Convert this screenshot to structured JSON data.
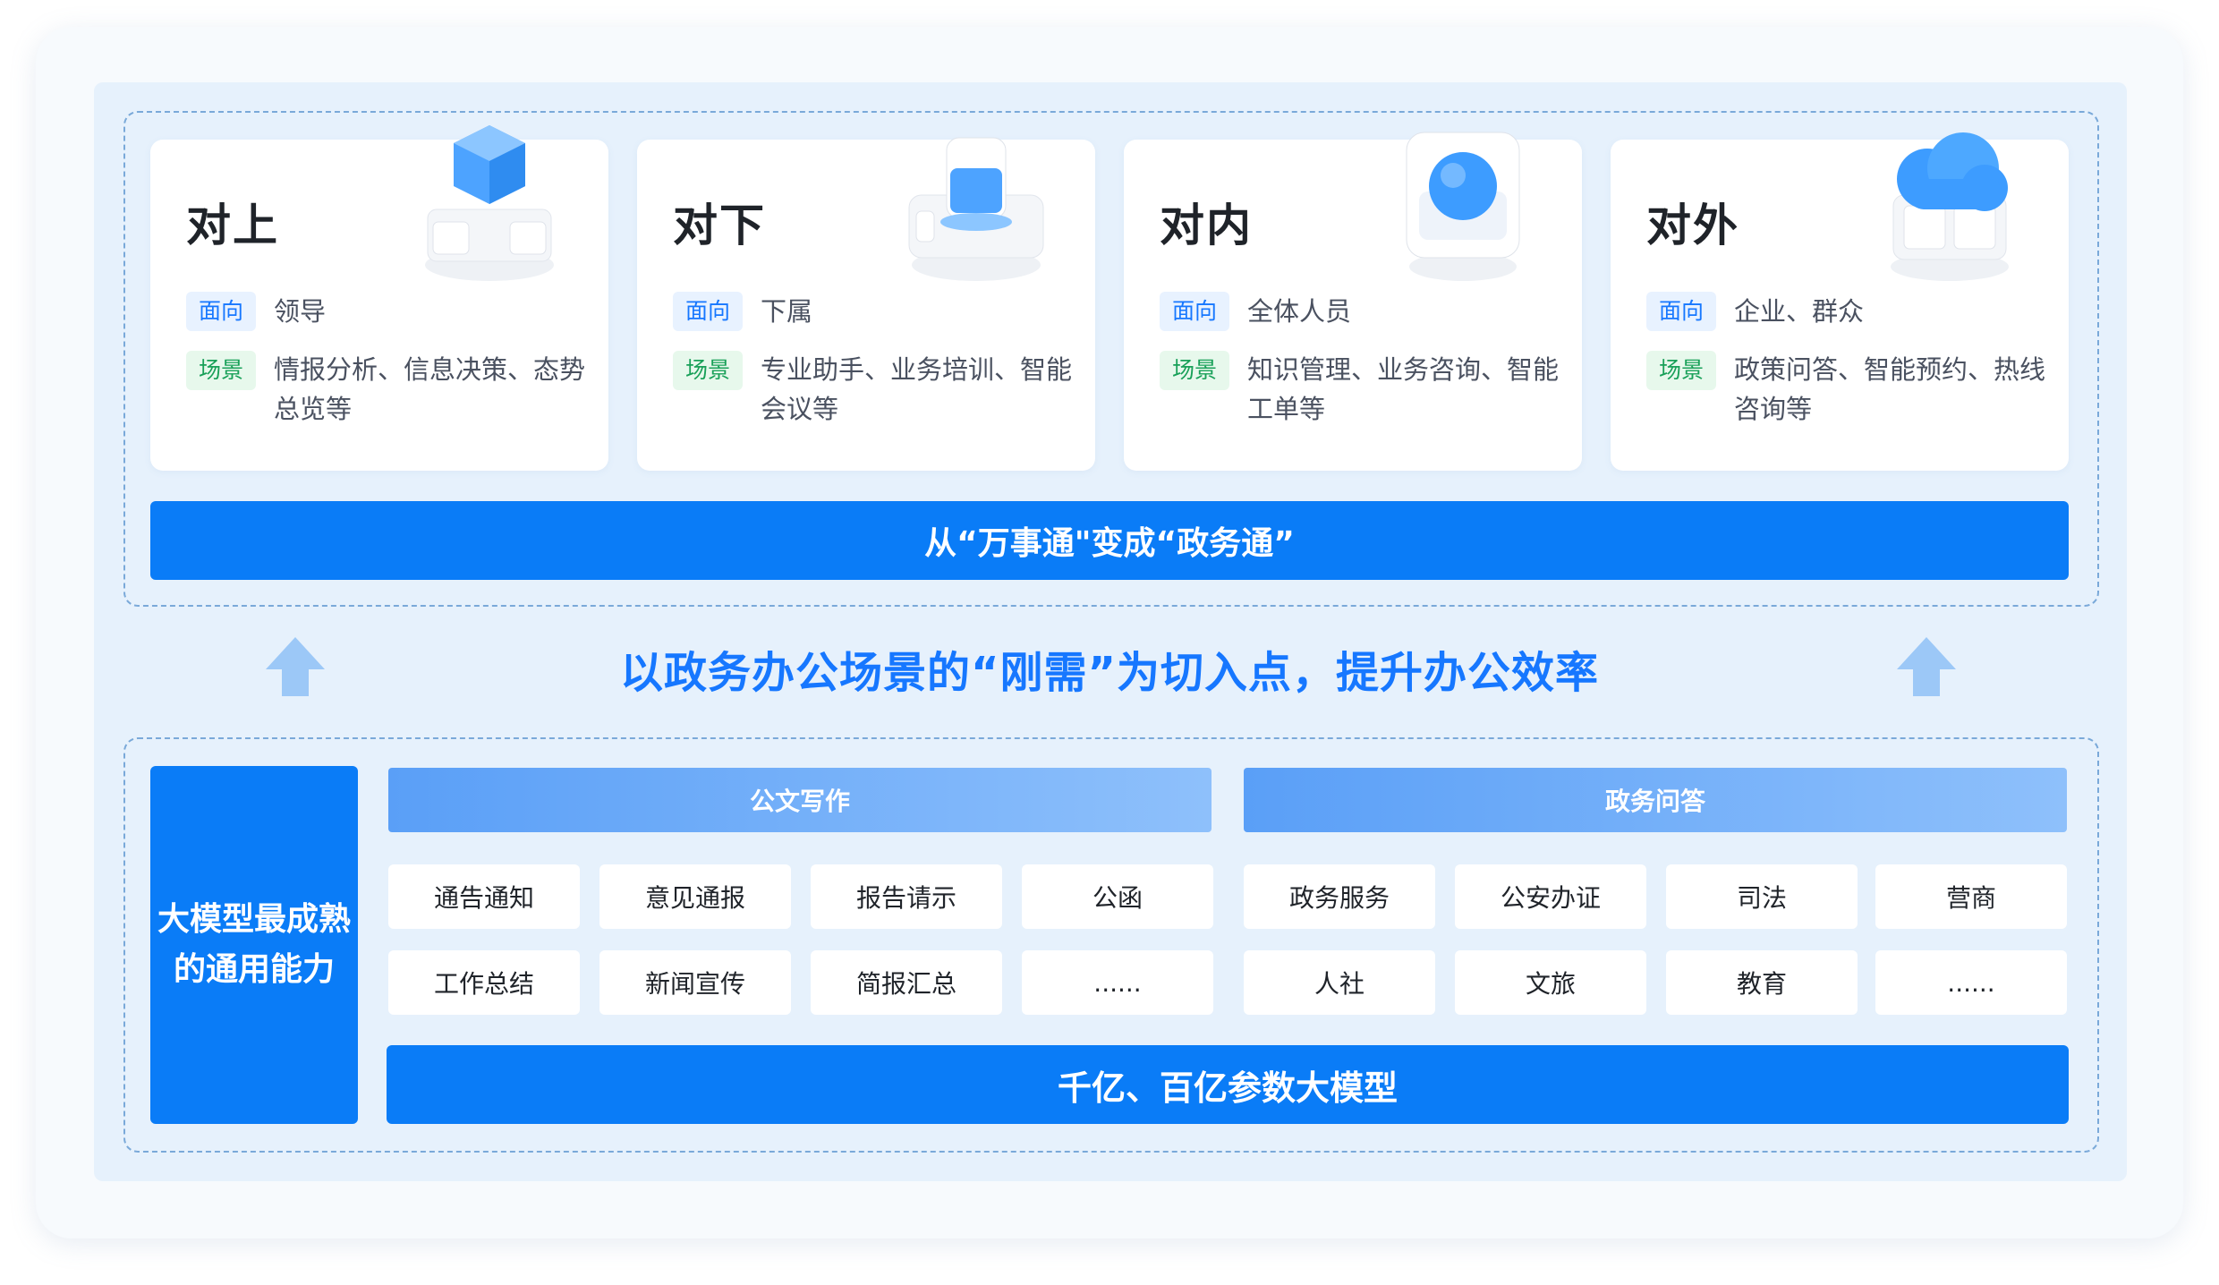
{
  "features": [
    {
      "title": "对上",
      "face_tag": "面向",
      "face_text": "领导",
      "scene_tag": "场景",
      "scene_text": "情报分析、信息决策、态势总览等",
      "icon": "cube-server-icon"
    },
    {
      "title": "对下",
      "face_tag": "面向",
      "face_text": "下属",
      "scene_tag": "场景",
      "scene_text": "专业助手、业务培训、智能会议等",
      "icon": "cylinder-server-icon"
    },
    {
      "title": "对内",
      "face_tag": "面向",
      "face_text": "全体人员",
      "scene_tag": "场景",
      "scene_text": "知识管理、业务咨询、智能工单等",
      "icon": "sphere-server-icon"
    },
    {
      "title": "对外",
      "face_tag": "面向",
      "face_text": "企业、群众",
      "scene_tag": "场景",
      "scene_text": "政策问答、智能预约、热线咨询等",
      "icon": "cloud-server-icon"
    }
  ],
  "top_banner": "从“万事通\"变成“政务通”",
  "slogan": "以政务办公场景的“刚需”为切入点，提升办公效率",
  "left_block": {
    "line1": "大模型最成熟",
    "line2": "的通用能力"
  },
  "categories": [
    {
      "name": "公文写作",
      "items": [
        "通告通知",
        "意见通报",
        "报告请示",
        "公函",
        "工作总结",
        "新闻宣传",
        "简报汇总",
        "......"
      ]
    },
    {
      "name": "政务问答",
      "items": [
        "政务服务",
        "公安办证",
        "司法",
        "营商",
        "人社",
        "文旅",
        "教育",
        "......"
      ]
    }
  ],
  "bottom_banner": "千亿、百亿参数大模型",
  "colors": {
    "primary": "#0a7cf7",
    "accent_text": "#1677ff",
    "panel": "#e6f1fc",
    "tag_blue": "#1677ff",
    "tag_green": "#18a058"
  }
}
